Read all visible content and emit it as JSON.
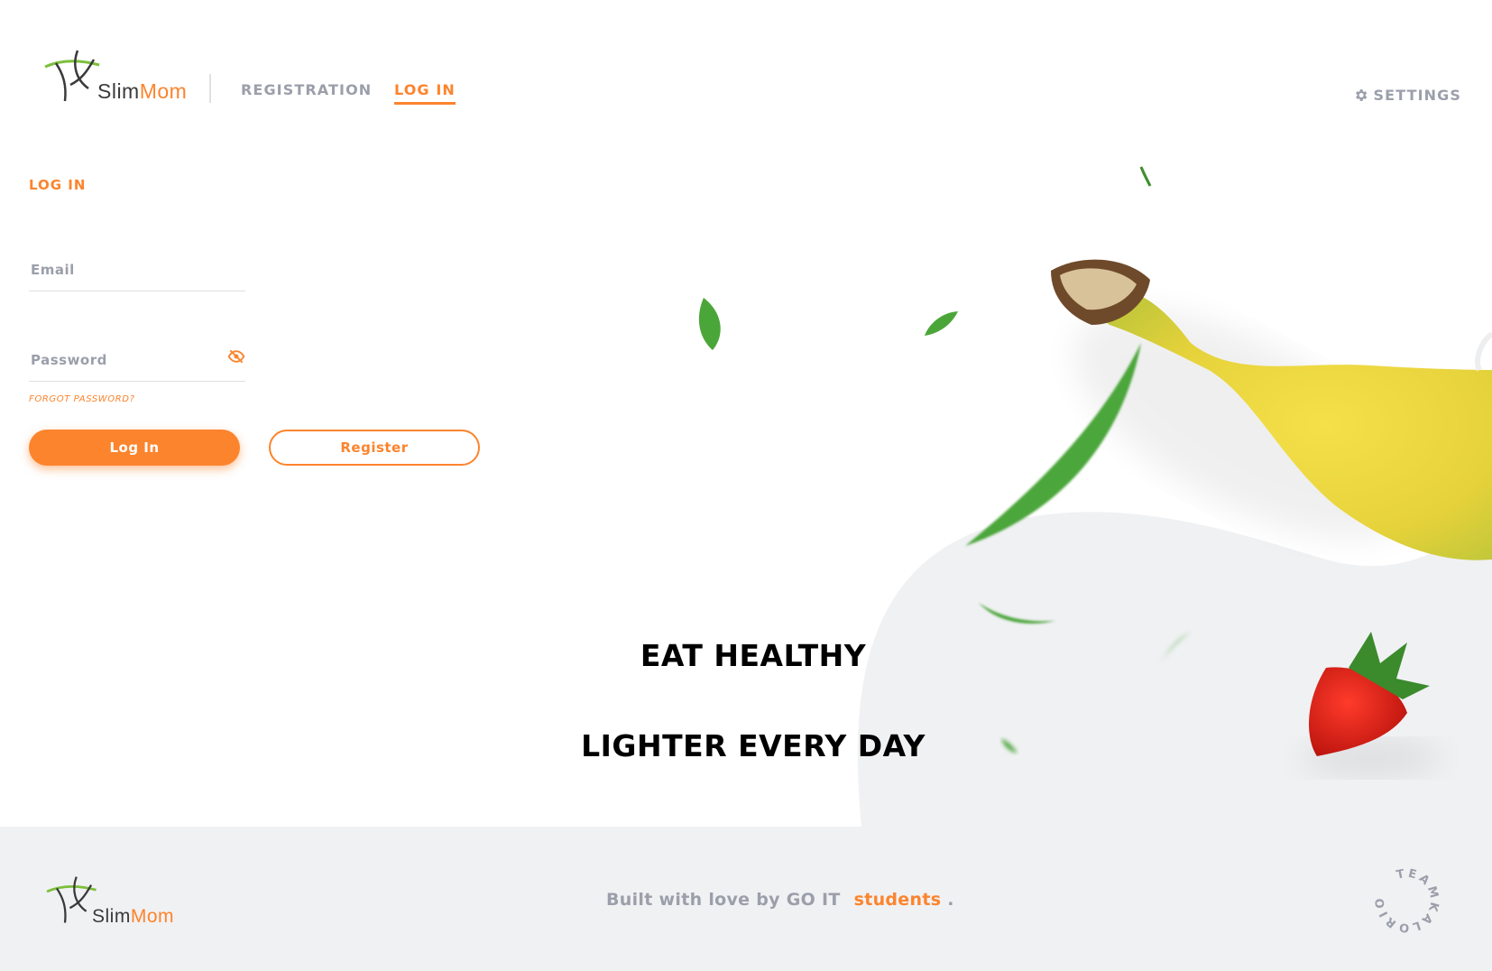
{
  "header": {
    "logo": {
      "part1": "Slim",
      "part2": "Mom"
    },
    "nav": {
      "registration": "REGISTRATION",
      "login": "LOG IN"
    },
    "settings_label": "SETTINGS"
  },
  "form": {
    "title": "LOG IN",
    "email_placeholder": "Email",
    "password_placeholder": "Password",
    "forgot_password": "FORGOT PASSWORD?",
    "login_button": "Log In",
    "register_button": "Register"
  },
  "hero": {
    "slogan_line1": "EAT HEALTHY",
    "slogan_line2": "LIGHTER EVERY DAY"
  },
  "footer": {
    "logo": {
      "part1": "Slim",
      "part2": "Mom"
    },
    "built_with": "Built with love by GO IT",
    "students": "students",
    "period": ".",
    "team_name": "TEAMKALORIO"
  },
  "colors": {
    "accent": "#fc842d",
    "muted": "#9b9faa",
    "footer_bg": "#f0f1f3"
  },
  "icons": [
    "logo-figure-icon",
    "gear-icon",
    "eye-off-icon",
    "team-badge-icon"
  ]
}
